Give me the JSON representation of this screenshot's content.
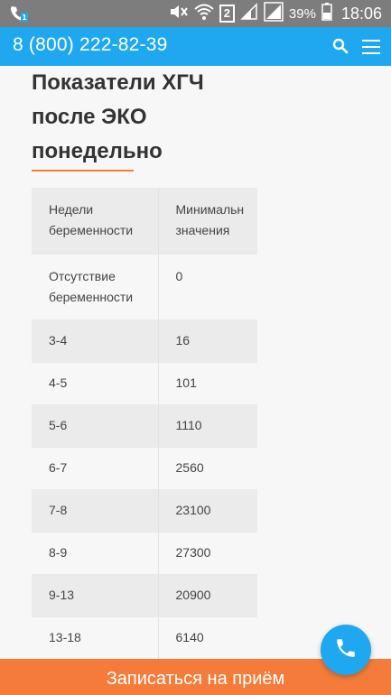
{
  "status_bar": {
    "battery_percent": "39%",
    "time": "18:06",
    "sim_badge": "2"
  },
  "header": {
    "phone": "8 (800) 222-82-39"
  },
  "article": {
    "title_lines": [
      "Показатели ХГЧ",
      "после ЭКО",
      "понедельно"
    ]
  },
  "table": {
    "headers": [
      [
        "Недели",
        "беременности"
      ],
      [
        "Минимальн",
        "значения"
      ]
    ],
    "rows": [
      {
        "week": [
          "Отсутствие",
          "беременности"
        ],
        "min": "0"
      },
      {
        "week": [
          "3-4"
        ],
        "min": "16"
      },
      {
        "week": [
          "4-5"
        ],
        "min": "101"
      },
      {
        "week": [
          "5-6"
        ],
        "min": "1110"
      },
      {
        "week": [
          "6-7"
        ],
        "min": "2560"
      },
      {
        "week": [
          "7-8"
        ],
        "min": "23100"
      },
      {
        "week": [
          "8-9"
        ],
        "min": "27300"
      },
      {
        "week": [
          "9-13"
        ],
        "min": "20900"
      },
      {
        "week": [
          "13-18"
        ],
        "min": "6140"
      }
    ]
  },
  "cta": {
    "label": "Записаться на приём"
  },
  "colors": {
    "brand_blue": "#1fa8ef",
    "accent_orange": "#f47b3a",
    "status_bar": "#7d7d7d"
  }
}
